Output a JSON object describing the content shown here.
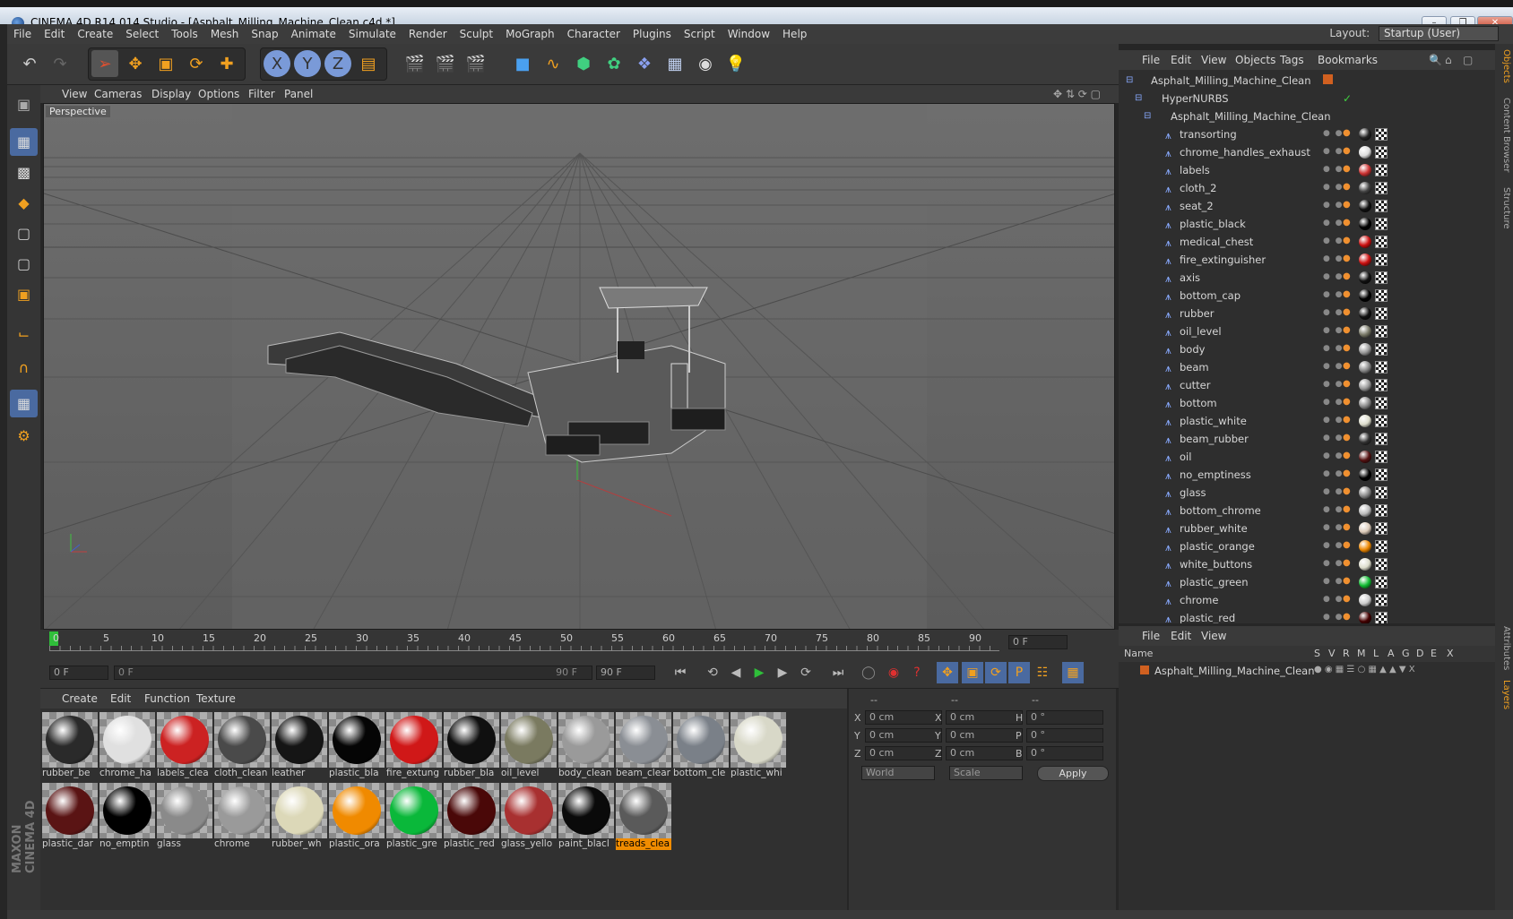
{
  "window": {
    "title": "CINEMA 4D R14.014 Studio - [Asphalt_Milling_Machine_Clean.c4d *]",
    "buttons": [
      "minimize-icon",
      "maximize-icon",
      "close-icon"
    ]
  },
  "menubar": {
    "items": [
      "File",
      "Edit",
      "Create",
      "Select",
      "Tools",
      "Mesh",
      "Snap",
      "Animate",
      "Simulate",
      "Render",
      "Sculpt",
      "MoGraph",
      "Character",
      "Plugins",
      "Script",
      "Window",
      "Help"
    ],
    "layout_label": "Layout:",
    "layout_value": "Startup (User)"
  },
  "viewport": {
    "menu": [
      "View",
      "Cameras",
      "Display",
      "Options",
      "Filter",
      "Panel"
    ],
    "camera_label": "Perspective"
  },
  "timeline": {
    "ticks": [
      "0",
      "5",
      "10",
      "15",
      "20",
      "25",
      "30",
      "35",
      "40",
      "45",
      "50",
      "55",
      "60",
      "65",
      "70",
      "75",
      "80",
      "85",
      "90"
    ],
    "current_frame": "0 F",
    "start_frame": "0 F",
    "range_start": "0 F",
    "range_end": "90 F",
    "end_frame": "90 F"
  },
  "materials": {
    "menu": [
      "Create",
      "Edit",
      "Function",
      "Texture"
    ],
    "items": [
      {
        "label": "rubber_be",
        "color": "#2a2a2a"
      },
      {
        "label": "chrome_ha",
        "color": "#e0e0e0"
      },
      {
        "label": "labels_clea",
        "color": "#cc2222"
      },
      {
        "label": "cloth_clean",
        "color": "#4a4a4a"
      },
      {
        "label": "leather",
        "color": "#151515"
      },
      {
        "label": "plastic_bla",
        "color": "#050505"
      },
      {
        "label": "fire_extung",
        "color": "#d01818"
      },
      {
        "label": "rubber_bla",
        "color": "#101010"
      },
      {
        "label": "oil_level",
        "color": "#7a7a60"
      },
      {
        "label": "body_clean",
        "color": "#9a9a9a"
      },
      {
        "label": "beam_clear",
        "color": "#8a8e94"
      },
      {
        "label": "bottom_cle",
        "color": "#7a8088"
      },
      {
        "label": "plastic_whi",
        "color": "#d8d8c8"
      },
      {
        "label": "plastic_dar",
        "color": "#5a1414"
      },
      {
        "label": "no_emptin",
        "color": "#000000"
      },
      {
        "label": "glass",
        "color": "#8a8a8a"
      },
      {
        "label": "chrome",
        "color": "#9a9a9a"
      },
      {
        "label": "rubber_wh",
        "color": "#dcd8b8"
      },
      {
        "label": "plastic_ora",
        "color": "#f08a00"
      },
      {
        "label": "plastic_gre",
        "color": "#0ab83a"
      },
      {
        "label": "plastic_red",
        "color": "#4a0808"
      },
      {
        "label": "glass_yello",
        "color": "#a83030"
      },
      {
        "label": "paint_blacl",
        "color": "#0a0a0a"
      },
      {
        "label": "treads_clea",
        "color": "#5a5a5a"
      }
    ]
  },
  "coordinates": {
    "headers": [
      "--",
      "--",
      "--"
    ],
    "rows": [
      {
        "a": "X",
        "av": "0 cm",
        "b": "X",
        "bv": "0 cm",
        "c": "H",
        "cv": "0 °"
      },
      {
        "a": "Y",
        "av": "0 cm",
        "b": "Y",
        "bv": "0 cm",
        "c": "P",
        "cv": "0 °"
      },
      {
        "a": "Z",
        "av": "0 cm",
        "b": "Z",
        "bv": "0 cm",
        "c": "B",
        "cv": "0 °"
      }
    ],
    "mode1": "World",
    "mode2": "Scale",
    "apply": "Apply"
  },
  "objects": {
    "menu": [
      "File",
      "Edit",
      "View",
      "Objects",
      "Tags",
      "Bookmarks"
    ],
    "root": "Asphalt_Milling_Machine_Clean",
    "hypernurbs": "HyperNURBS",
    "group": "Asphalt_Milling_Machine_Clean",
    "children": [
      {
        "name": "transorting",
        "color": "#222"
      },
      {
        "name": "chrome_handles_exhaust",
        "color": "#ddd"
      },
      {
        "name": "labels",
        "color": "#c33"
      },
      {
        "name": "cloth_2",
        "color": "#444"
      },
      {
        "name": "seat_2",
        "color": "#111"
      },
      {
        "name": "plastic_black",
        "color": "#000"
      },
      {
        "name": "medical_chest",
        "color": "#c11"
      },
      {
        "name": "fire_extinguisher",
        "color": "#c11"
      },
      {
        "name": "axis",
        "color": "#111"
      },
      {
        "name": "bottom_cap",
        "color": "#000"
      },
      {
        "name": "rubber",
        "color": "#111"
      },
      {
        "name": "oil_level",
        "color": "#776"
      },
      {
        "name": "body",
        "color": "#999"
      },
      {
        "name": "beam",
        "color": "#888"
      },
      {
        "name": "cutter",
        "color": "#999"
      },
      {
        "name": "bottom",
        "color": "#888"
      },
      {
        "name": "plastic_white",
        "color": "#ddc"
      },
      {
        "name": "beam_rubber",
        "color": "#333"
      },
      {
        "name": "oil",
        "color": "#511"
      },
      {
        "name": "no_emptiness",
        "color": "#000"
      },
      {
        "name": "glass",
        "color": "#888"
      },
      {
        "name": "bottom_chrome",
        "color": "#bbb"
      },
      {
        "name": "rubber_white",
        "color": "#dcb"
      },
      {
        "name": "plastic_orange",
        "color": "#e80"
      },
      {
        "name": "white_buttons",
        "color": "#ddc"
      },
      {
        "name": "plastic_green",
        "color": "#1b3"
      },
      {
        "name": "chrome",
        "color": "#ccc"
      },
      {
        "name": "plastic_red",
        "color": "#400"
      }
    ]
  },
  "layers": {
    "menu": [
      "File",
      "Edit",
      "View"
    ],
    "columns": [
      "Name",
      "S",
      "V",
      "R",
      "M",
      "L",
      "A",
      "G",
      "D",
      "E",
      "X"
    ],
    "row": "Asphalt_Milling_Machine_Clean"
  },
  "right_tabs": [
    "Objects",
    "Content Browser",
    "Structure",
    "Attributes",
    "Layers"
  ],
  "brand": "MAXON CINEMA 4D"
}
